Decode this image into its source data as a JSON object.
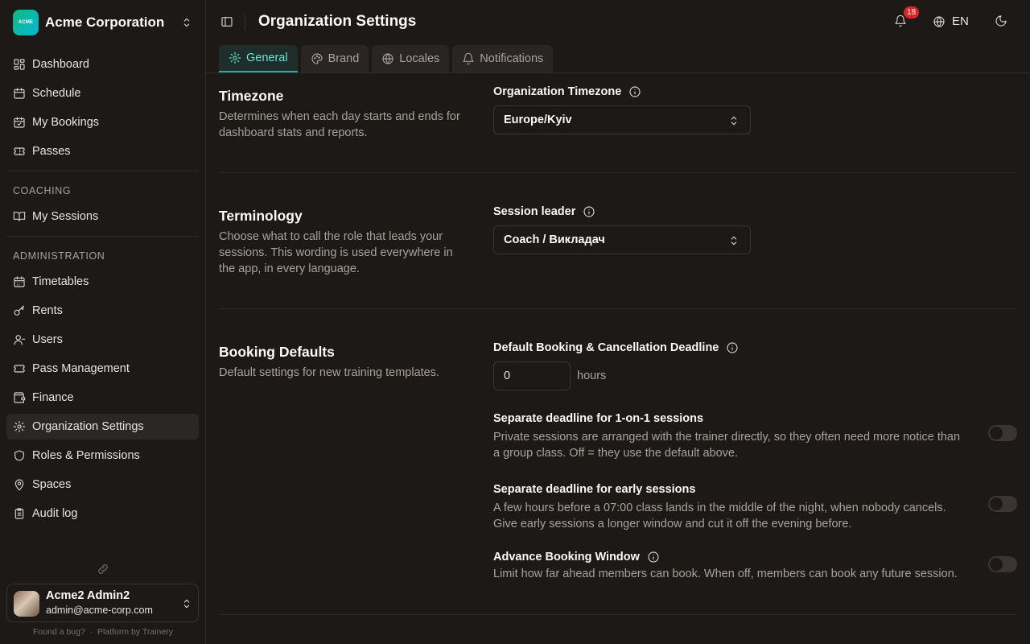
{
  "org": {
    "name": "Acme Corporation",
    "logo_text": "ACME"
  },
  "nav": {
    "dashboard": "Dashboard",
    "schedule": "Schedule",
    "my_bookings": "My Bookings",
    "passes": "Passes",
    "coaching_header": "COACHING",
    "my_sessions": "My Sessions",
    "admin_header": "ADMINISTRATION",
    "timetables": "Timetables",
    "rents": "Rents",
    "users": "Users",
    "pass_management": "Pass Management",
    "finance": "Finance",
    "org_settings": "Organization Settings",
    "roles": "Roles & Permissions",
    "spaces": "Spaces",
    "audit_log": "Audit log"
  },
  "user": {
    "name": "Acme2 Admin2",
    "email": "admin@acme-corp.com"
  },
  "footer": {
    "bug": "Found a bug?",
    "sep": "·",
    "platform": "Platform by Trainery"
  },
  "header": {
    "title": "Organization Settings",
    "notifications_count": "18",
    "language": "EN"
  },
  "tabs": {
    "general": "General",
    "brand": "Brand",
    "locales": "Locales",
    "notifications": "Notifications"
  },
  "timezone": {
    "title": "Timezone",
    "description": "Determines when each day starts and ends for dashboard stats and reports.",
    "field_label": "Organization Timezone",
    "value": "Europe/Kyiv"
  },
  "terminology": {
    "title": "Terminology",
    "description": "Choose what to call the role that leads your sessions. This wording is used everywhere in the app, in every language.",
    "field_label": "Session leader",
    "value": "Coach / Викладач"
  },
  "booking": {
    "title": "Booking Defaults",
    "description": "Default settings for new training templates.",
    "deadline_label": "Default Booking & Cancellation Deadline",
    "deadline_value": "0",
    "deadline_unit": "hours",
    "one_on_one_title": "Separate deadline for 1-on-1 sessions",
    "one_on_one_desc": "Private sessions are arranged with the trainer directly, so they often need more notice than a group class. Off = they use the default above.",
    "early_title": "Separate deadline for early sessions",
    "early_desc": "A few hours before a 07:00 class lands in the middle of the night, when nobody cancels. Give early sessions a longer window and cut it off the evening before.",
    "advance_title": "Advance Booking Window",
    "advance_desc": "Limit how far ahead members can book. When off, members can book any future session.",
    "toggles": {
      "one_on_one": false,
      "early": false,
      "advance": false
    }
  },
  "colors": {
    "accent": "#14b8a6",
    "badge": "#dc2626",
    "background": "#1c1917"
  }
}
